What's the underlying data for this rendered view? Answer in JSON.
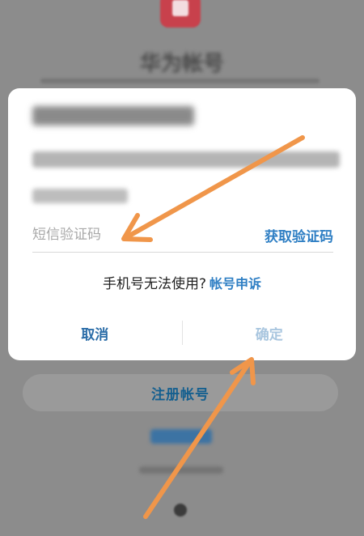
{
  "background": {
    "page_title": "华为帐号",
    "register_label": "注册帐号"
  },
  "dialog": {
    "sms_placeholder": "短信验证码",
    "get_code_label": "获取验证码",
    "phone_unusable_text": "手机号无法使用?",
    "appeal_label": "帐号申诉",
    "cancel_label": "取消",
    "confirm_label": "确定"
  },
  "colors": {
    "accent": "#2f7fc4",
    "annotation_arrow": "#f0964a",
    "dim_overlay": "#8c8c8c"
  }
}
